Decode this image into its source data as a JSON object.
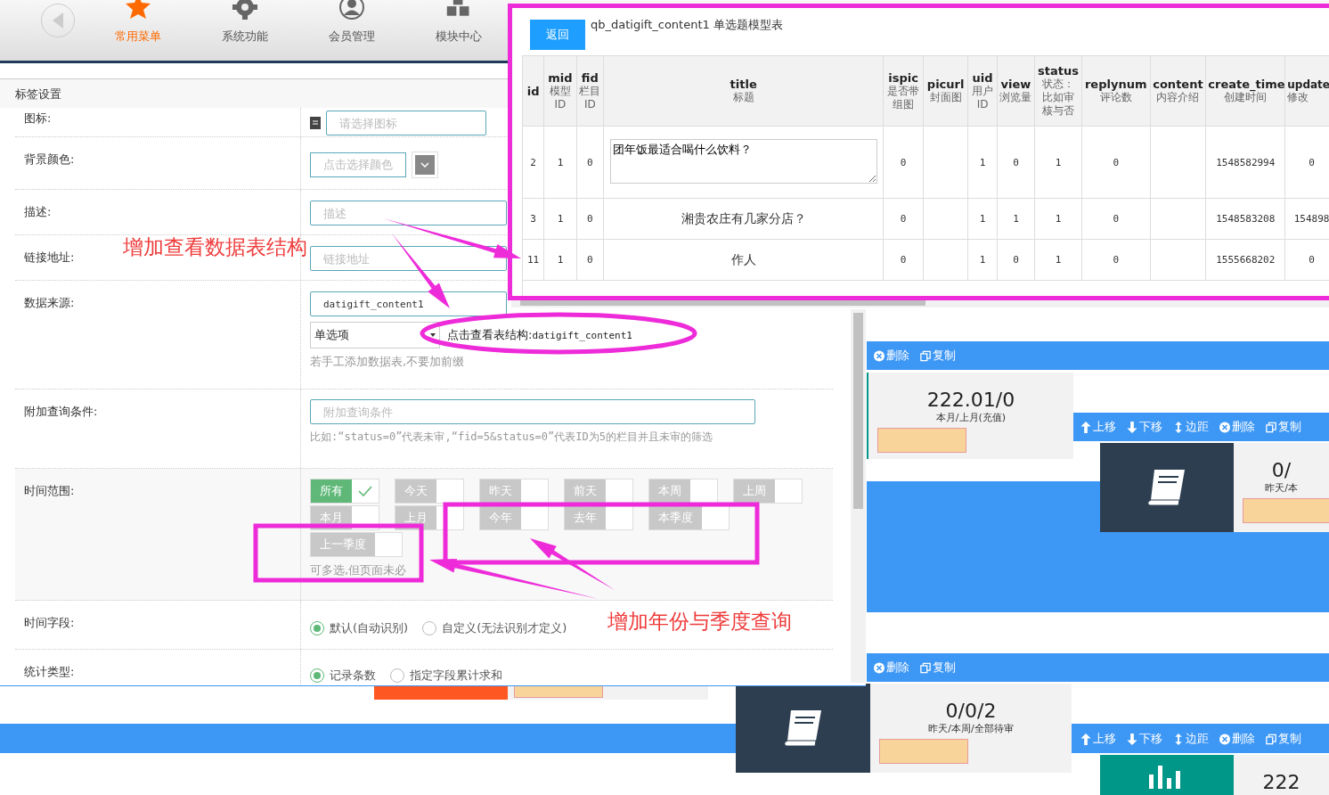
{
  "nav": {
    "items": [
      {
        "label": "常用菜单",
        "selected": true
      },
      {
        "label": "系统功能",
        "selected": false
      },
      {
        "label": "会员管理",
        "selected": false
      },
      {
        "label": "模块中心",
        "selected": false
      }
    ]
  },
  "dashboard": {
    "toolbars": [
      {
        "buttons": [
          {
            "label": "删除"
          },
          {
            "label": "复制"
          }
        ]
      },
      {
        "buttons": [
          {
            "label": "上移"
          },
          {
            "label": "下移"
          },
          {
            "label": "边距"
          },
          {
            "label": "删除"
          },
          {
            "label": "复制"
          }
        ]
      },
      {
        "buttons": [
          {
            "label": "删除"
          },
          {
            "label": "复制"
          }
        ]
      },
      {
        "buttons": [
          {
            "label": "上移"
          },
          {
            "label": "下移"
          },
          {
            "label": "边距"
          },
          {
            "label": "删除"
          },
          {
            "label": "复制"
          }
        ]
      }
    ],
    "stats": [
      {
        "value": "222.01/0",
        "caption": "本月/上月(充值)"
      },
      {
        "value": "0/",
        "caption": "昨天/本"
      },
      {
        "value": "0/0/2",
        "caption": "昨天/本周/全部待审"
      },
      {
        "value": "222"
      }
    ]
  },
  "dialog": {
    "title": "标签设置",
    "rows": [
      {
        "kind": "icon_field",
        "label": "图标:",
        "placeholder": "请选择图标"
      },
      {
        "kind": "color",
        "label": "背景颜色:",
        "button": "点击选择颜色"
      },
      {
        "kind": "text",
        "label": "描述:",
        "placeholder": "描述"
      },
      {
        "kind": "text",
        "label": "链接地址:",
        "placeholder": "链接地址"
      },
      {
        "kind": "source",
        "label": "数据来源:",
        "value": "datigift_content1",
        "select": "单选项",
        "link": "点击查看表结构:datigift_content1",
        "hint": "若手工添加数据表,不要加前缀"
      },
      {
        "kind": "text",
        "label": "附加查询条件:",
        "placeholder": "附加查询条件",
        "hint": "比如:“status=0”代表未审,“fid=5&status=0”代表ID为5的栏目并且未审的筛选"
      },
      {
        "kind": "tags",
        "label": "时间范围:",
        "options": [
          {
            "label": "所有",
            "selected": true
          },
          {
            "label": "今天",
            "selected": false
          },
          {
            "label": "昨天",
            "selected": false
          },
          {
            "label": "前天",
            "selected": false
          },
          {
            "label": "本周",
            "selected": false
          },
          {
            "label": "上周",
            "selected": false
          },
          {
            "label": "本月",
            "selected": false
          },
          {
            "label": "上月",
            "selected": false
          },
          {
            "label": "今年",
            "selected": false
          },
          {
            "label": "去年",
            "selected": false
          },
          {
            "label": "本季度",
            "selected": false
          },
          {
            "label": "上一季度",
            "selected": false
          }
        ],
        "hint": "可多选,但页面未必"
      },
      {
        "kind": "radios",
        "label": "时间字段:",
        "options": [
          {
            "label": "默认(自动识别)",
            "selected": true
          },
          {
            "label": "自定义(无法识别才定义)",
            "selected": false
          }
        ]
      },
      {
        "kind": "radios",
        "label": "统计类型:",
        "options": [
          {
            "label": "记录条数",
            "selected": true
          },
          {
            "label": "指定字段累计求和",
            "selected": false
          }
        ]
      }
    ]
  },
  "table_view": {
    "back_button": "返回",
    "title": "qb_datigift_content1 单选题模型表",
    "columns": [
      {
        "name": "id"
      },
      {
        "name": "mid",
        "desc": "模型ID"
      },
      {
        "name": "fid",
        "desc": "栏目ID"
      },
      {
        "name": "title",
        "desc": "标题"
      },
      {
        "name": "ispic",
        "desc": "是否带组图"
      },
      {
        "name": "picurl",
        "desc": "封面图"
      },
      {
        "name": "uid",
        "desc": "用户ID"
      },
      {
        "name": "view",
        "desc": "浏览量"
      },
      {
        "name": "status",
        "desc": "状态：比如审核与否"
      },
      {
        "name": "replynum",
        "desc": "评论数"
      },
      {
        "name": "content",
        "desc": "内容介绍"
      },
      {
        "name": "create_time",
        "desc": "创建时间"
      },
      {
        "name": "update",
        "desc": "修改"
      }
    ],
    "rows": [
      {
        "kind": "editing",
        "cells": [
          "2",
          "1",
          "0",
          "团年饭最适合喝什么饮料？",
          "0",
          null,
          "1",
          "0",
          "1",
          "0",
          null,
          "1548582994",
          "0"
        ]
      },
      {
        "kind": "plain",
        "cells": [
          "3",
          "1",
          "0",
          "湘贵农庄有几家分店？",
          "0",
          null,
          "1",
          "1",
          "1",
          "0",
          null,
          "1548583208",
          "154898"
        ]
      },
      {
        "kind": "plain",
        "cells": [
          "11",
          "1",
          "0",
          "作人",
          "0",
          null,
          "1",
          "0",
          "1",
          "0",
          null,
          "1555668202",
          "0"
        ]
      }
    ]
  },
  "annotations": [
    {
      "text": "增加查看数据表结构"
    },
    {
      "text": "增加年份与季度查询"
    }
  ]
}
